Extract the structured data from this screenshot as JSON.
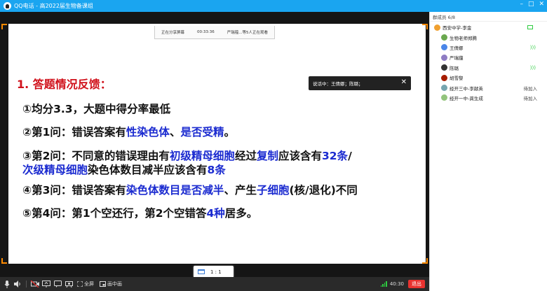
{
  "window": {
    "title": "QQ电话 - 高2022届生物备课组",
    "controls": [
      "–",
      "□",
      "✕"
    ]
  },
  "share_bar": {
    "status": "正在分享屏幕",
    "timer": "00:33:36",
    "viewers": "严瑞蕴...等5人正在观看"
  },
  "speaking": {
    "text": "说话中：王倩娜；陈璐；"
  },
  "slide": {
    "heading": "1. 答题情况反馈：",
    "lines": [
      [
        {
          "t": "①均分3.3，大题中得分率最低",
          "hl": false
        }
      ],
      [
        {
          "t": "②第1问：错误答案有",
          "hl": false
        },
        {
          "t": "性染色体",
          "hl": true
        },
        {
          "t": "、",
          "hl": false
        },
        {
          "t": "是否受精",
          "hl": true
        },
        {
          "t": "。",
          "hl": false
        }
      ],
      [
        {
          "t": "③第2问：不同意的错误理由有",
          "hl": false
        },
        {
          "t": "初级精母细胞",
          "hl": true
        },
        {
          "t": "经过",
          "hl": false
        },
        {
          "t": "复制",
          "hl": true
        },
        {
          "t": "应该含有",
          "hl": false
        },
        {
          "t": "32条",
          "hl": true
        },
        {
          "t": "/",
          "hl": false
        }
      ],
      [
        {
          "t": "次级精母细胞",
          "hl": true
        },
        {
          "t": "染色体数目减半应该含有",
          "hl": false
        },
        {
          "t": "8条",
          "hl": true
        }
      ],
      [
        {
          "t": "④第3问：错误答案有",
          "hl": false
        },
        {
          "t": "染色体数目是否减半",
          "hl": true
        },
        {
          "t": "、产生",
          "hl": false
        },
        {
          "t": "子细胞",
          "hl": true
        },
        {
          "t": "(核/退化)不同",
          "hl": false
        }
      ],
      [
        {
          "t": "⑤第4问：第1个空还行，第2个空错答",
          "hl": false
        },
        {
          "t": "4种",
          "hl": true
        },
        {
          "t": "居多。",
          "hl": false
        }
      ]
    ]
  },
  "zoom": {
    "label": "1 : 1"
  },
  "toolbar": {
    "fullscreen": "全屏",
    "pip": "画中画",
    "duration": "40:30",
    "exit": "退出"
  },
  "colors": {
    "accent": "#1aa5f0",
    "highlight": "#1b2bd0",
    "heading": "#d0101a",
    "exit": "#e8322f"
  },
  "members": {
    "header": "群成员 6/8",
    "list": [
      {
        "name": "西安中学-李金",
        "status": "",
        "speaking": false,
        "av": "#f0a030"
      },
      {
        "name": "生物老师郑腾",
        "status": "",
        "speaking": false,
        "av": "#6aa84f"
      },
      {
        "name": "王倩娜",
        "status": "",
        "speaking": true,
        "av": "#4a86e8"
      },
      {
        "name": "严瑞蕴",
        "status": "",
        "speaking": false,
        "av": "#8e7cc3"
      },
      {
        "name": "陈璐",
        "status": "",
        "speaking": true,
        "av": "#333333"
      },
      {
        "name": "胡雪黎",
        "status": "",
        "speaking": false,
        "av": "#a61c00"
      },
      {
        "name": "经开三中-李献英",
        "status": "待加入",
        "speaking": false,
        "av": "#76a5af"
      },
      {
        "name": "经开一中-龚生成",
        "status": "待加入",
        "speaking": false,
        "av": "#93c47d"
      }
    ]
  }
}
